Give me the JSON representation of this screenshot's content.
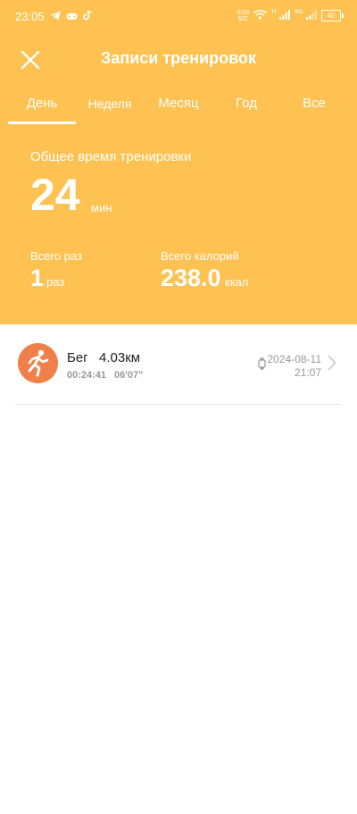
{
  "status_bar": {
    "time": "23:05",
    "net_rate_top": "0,00",
    "net_rate_bottom": "Б/С",
    "signal_type_1": "H",
    "signal_type_2": "4G",
    "battery": "40"
  },
  "header": {
    "title": "Записи тренировок",
    "background_color": "#FDC252"
  },
  "tabs": [
    {
      "label": "День",
      "active": true
    },
    {
      "label": "Неделя",
      "active": false
    },
    {
      "label": "Месяц",
      "active": false
    },
    {
      "label": "Год",
      "active": false
    },
    {
      "label": "Все",
      "active": false
    }
  ],
  "summary": {
    "total_time_label": "Общее время тренировки",
    "total_time_value": "24",
    "total_time_unit": "мин",
    "total_count_label": "Всего раз",
    "total_count_value": "1",
    "total_count_unit": "раз",
    "total_calories_label": "Всего калорий",
    "total_calories_value": "238.0",
    "total_calories_unit": "ккал"
  },
  "records": [
    {
      "type": "Бег",
      "distance": "4.03км",
      "duration": "00:24:41",
      "pace": "06'07\"",
      "date": "2024-08-11",
      "time": "21:07",
      "icon_color": "#F08049"
    }
  ]
}
